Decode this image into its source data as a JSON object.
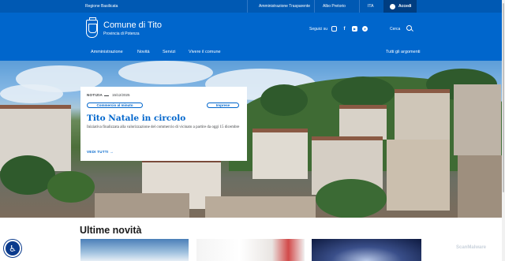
{
  "topbar": {
    "region": "Regione Basilicata",
    "admin_link": "Amministrazione Trasparente",
    "albo_link": "Albo Pretorio",
    "lang": "ITA",
    "login": "Accedi"
  },
  "header": {
    "town": "Comune di Tito",
    "province": "Provincia di Potenza",
    "follow": "Seguici su",
    "social": [
      "instagram-icon",
      "facebook-icon",
      "youtube-icon",
      "telegram-icon"
    ],
    "search": "Cerca"
  },
  "nav": {
    "items": [
      "Amministrazione",
      "Novità",
      "Servizi",
      "Vivere il comune"
    ],
    "all_topics": "Tutti gli argomenti"
  },
  "hero_card": {
    "category": "NOTIZIA",
    "date": "15/12/2025",
    "tags": [
      "Commercio al minuto",
      "Imprese"
    ],
    "title": "Tito Natale in circolo",
    "description": "Iniziativa finalizzata alla valorizzazione del commercio di vicinato a partire da oggi 15 dicembre",
    "see_all": "VEDI TUTTI"
  },
  "news": {
    "title": "Ultime novità"
  },
  "watermark": "ScanMalware",
  "colors": {
    "primary": "#0066cc",
    "topbar": "#0059b3",
    "login": "#003d80"
  }
}
